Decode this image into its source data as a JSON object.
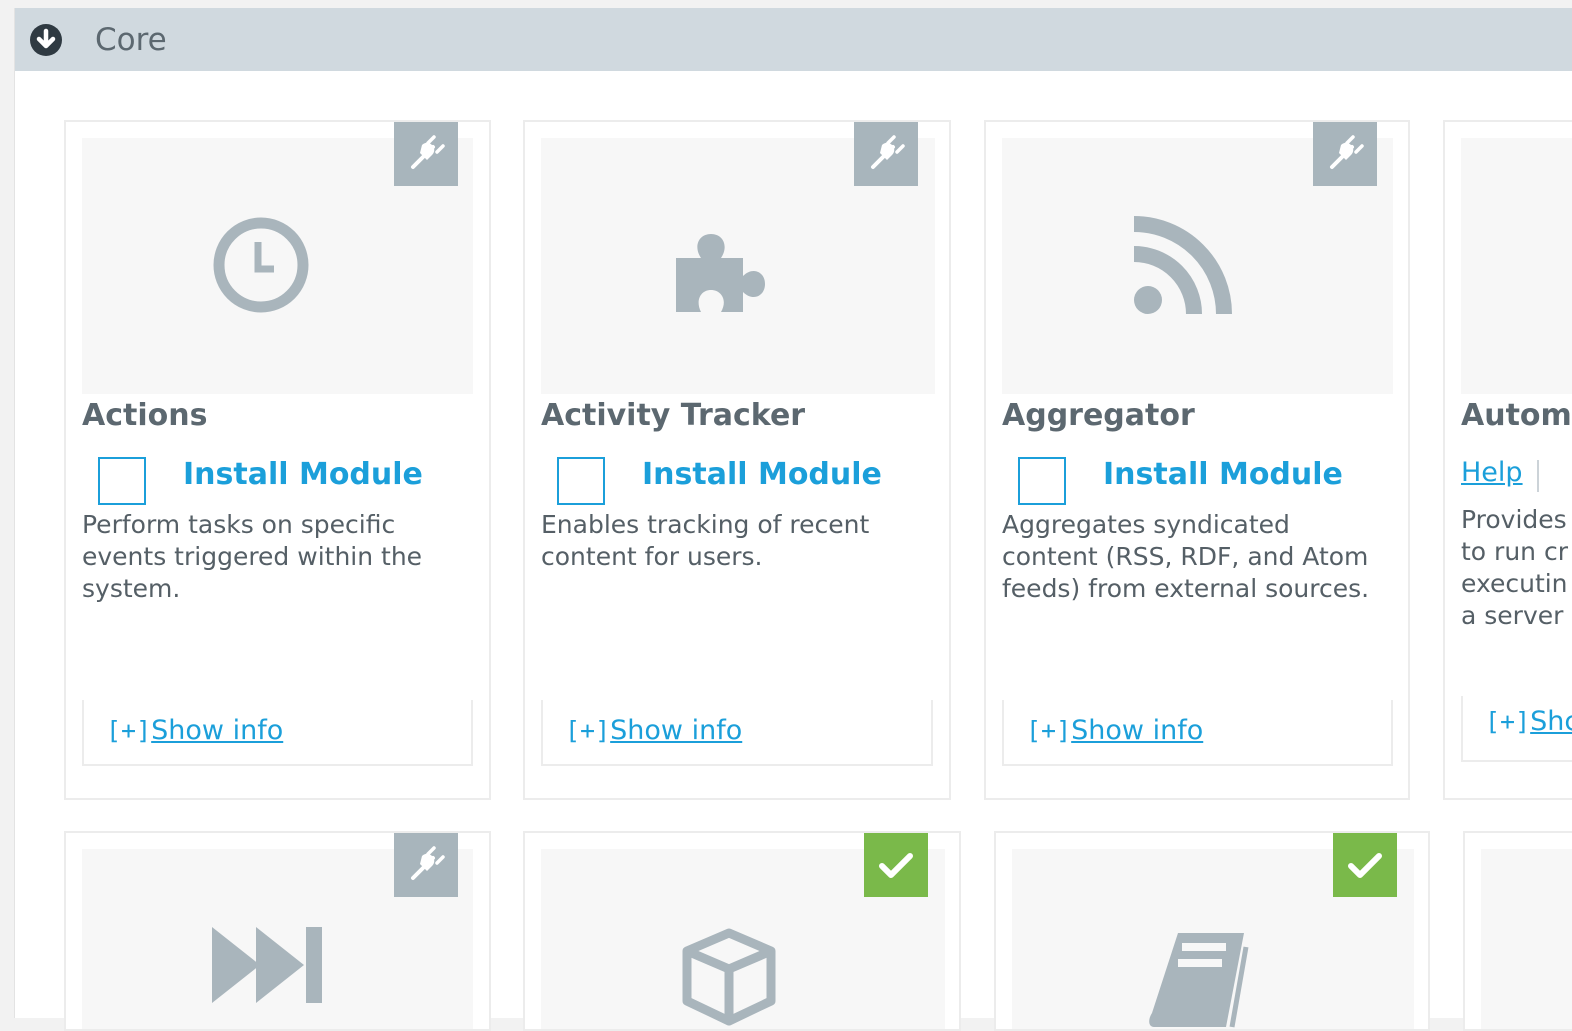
{
  "section": {
    "title": "Core",
    "toggle_icon": "chevron-down-circle-icon"
  },
  "colors": {
    "header_bg": "#d0d9df",
    "link": "#1b9fda",
    "plug_badge": "#a8b5bc",
    "installed_badge": "#7ab94a",
    "icon_gray": "#a9b5bc"
  },
  "modules": [
    {
      "name": "Actions",
      "icon": "clock-icon",
      "status_icon": "plug-icon",
      "install_label": "Install Module",
      "description": "Perform tasks on specific\nevents triggered within the\nsystem.",
      "info_prefix": "[+]",
      "info_label": "Show info"
    },
    {
      "name": "Activity Tracker",
      "icon": "puzzle-icon",
      "status_icon": "plug-icon",
      "install_label": "Install Module",
      "description": "Enables tracking of recent\ncontent for users.",
      "info_prefix": "[+]",
      "info_label": "Show info"
    },
    {
      "name": "Aggregator",
      "icon": "rss-icon",
      "status_icon": "plug-icon",
      "install_label": "Install Module",
      "description": "Aggregates syndicated\ncontent (RSS, RDF, and Atom\nfeeds) from external sources.",
      "info_prefix": "[+]",
      "info_label": "Show info"
    },
    {
      "name": "Autom",
      "help_label": "Help",
      "description": "Provides\nto run cr\nexecutin\na server",
      "info_prefix": "[+]",
      "info_label": "Shc"
    },
    {
      "icon": "fast-forward-icon",
      "status_icon": "plug-icon"
    },
    {
      "icon": "cube-icon",
      "status_icon": "check-icon"
    },
    {
      "icon": "book-icon",
      "status_icon": "check-icon"
    }
  ]
}
